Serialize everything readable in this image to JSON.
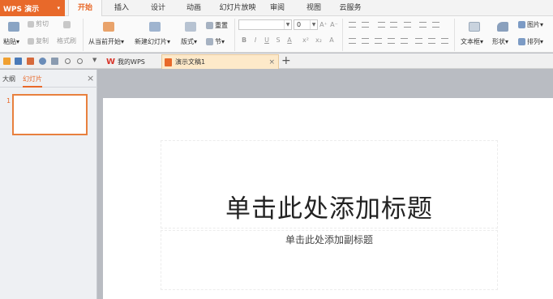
{
  "app": {
    "name": "WPS 演示",
    "menu_arrow": "▾"
  },
  "menu_tabs": [
    "开始",
    "插入",
    "设计",
    "动画",
    "幻灯片放映",
    "审阅",
    "视图",
    "云服务"
  ],
  "ribbon": {
    "paste": "粘贴▾",
    "cut": "剪切",
    "copy": "复制",
    "format_painter": "格式刷",
    "from_current": "从当前开始▾",
    "new_slide": "新建幻灯片▾",
    "layout": "版式▾",
    "reset": "重置",
    "section": "节▾",
    "font_size": "0",
    "textbox": "文本框▾",
    "shape": "形状▾",
    "picture": "图片▾",
    "arrange": "排列▾",
    "fmt_buttons": [
      "B",
      "I",
      "U",
      "S",
      "A",
      "x²",
      "x₂",
      "A"
    ],
    "grow_font": "A⁺",
    "shrink_font": "A⁻"
  },
  "doc_tabs": {
    "my_wps": "我的WPS",
    "current_doc": "演示文稿1",
    "close": "×",
    "new_tab": "+"
  },
  "left_panel": {
    "tab_outline": "大纲",
    "tab_slides": "幻灯片",
    "close": "×",
    "slide_number": "1"
  },
  "slide": {
    "title_placeholder": "单击此处添加标题",
    "subtitle_placeholder": "单击此处添加副标题"
  },
  "colors": {
    "accent": "#e8692a",
    "active_doc_tab": "#fde9c9",
    "canvas_bg": "#b9bcc2"
  }
}
